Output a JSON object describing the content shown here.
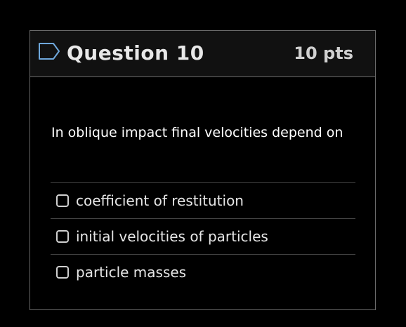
{
  "question": {
    "title": "Question 10",
    "points": "10 pts",
    "text": "In oblique impact final velocities depend on",
    "flag_icon": "bookmark-flag-icon",
    "answers": [
      {
        "label": "coefficient of restitution",
        "checked": false
      },
      {
        "label": "initial velocities of particles",
        "checked": false
      },
      {
        "label": "particle masses",
        "checked": false
      }
    ]
  },
  "colors": {
    "background": "#000000",
    "header_bg": "#111111",
    "border": "#6a6a6a",
    "text": "#ffffff"
  }
}
